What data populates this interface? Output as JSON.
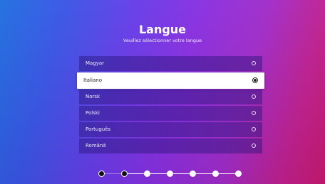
{
  "screen": {
    "title": "Langue",
    "subtitle": "Veuillez sélectionner votre langue"
  },
  "languages": [
    {
      "label": "Magyar",
      "selected": false
    },
    {
      "label": "Italiano",
      "selected": true
    },
    {
      "label": "Norsk",
      "selected": false
    },
    {
      "label": "Polski",
      "selected": false
    },
    {
      "label": "Português",
      "selected": false
    },
    {
      "label": "Română",
      "selected": false
    }
  ],
  "progress": {
    "total_steps": 7,
    "current_step": 2
  },
  "colors": {
    "gradient_start": "#1f6fe0",
    "gradient_mid": "#8a2fe0",
    "gradient_end": "#c8196f",
    "selected_row": "#ffffff"
  }
}
